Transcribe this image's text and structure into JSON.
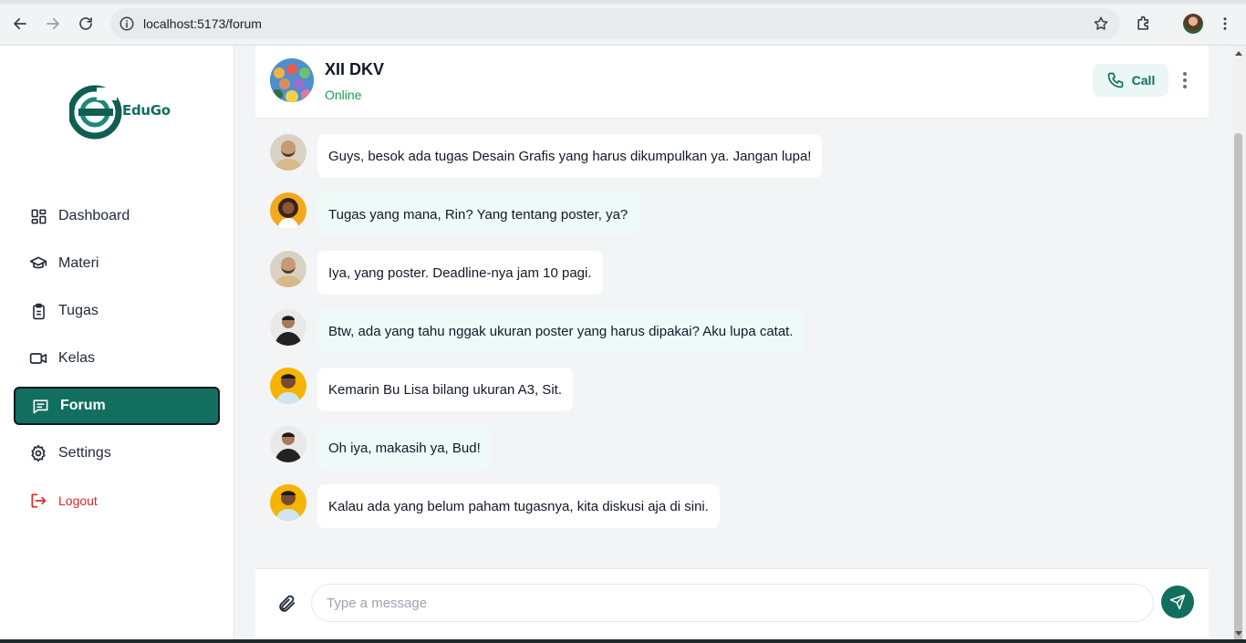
{
  "browser": {
    "url": "localhost:5173/forum"
  },
  "sidebar": {
    "logo_text": "EduGo",
    "items": [
      {
        "label": "Dashboard",
        "icon": "dashboard-icon"
      },
      {
        "label": "Materi",
        "icon": "graduation-cap-icon"
      },
      {
        "label": "Tugas",
        "icon": "clipboard-icon"
      },
      {
        "label": "Kelas",
        "icon": "video-icon"
      },
      {
        "label": "Forum",
        "icon": "message-icon",
        "active": true
      },
      {
        "label": "Settings",
        "icon": "gear-icon"
      }
    ],
    "logout_label": "Logout"
  },
  "chat": {
    "group_name": "XII DKV",
    "status": "Online",
    "call_label": "Call"
  },
  "messages": [
    {
      "text": "Guys, besok ada tugas Desain Grafis yang harus dikumpulkan ya. Jangan lupa!",
      "style": "white",
      "avatar": "man-beard-1"
    },
    {
      "text": "Tugas yang mana, Rin? Yang tentang poster, ya?",
      "style": "mint",
      "avatar": "woman-curly"
    },
    {
      "text": "Iya, yang poster. Deadline-nya jam 10 pagi.",
      "style": "white",
      "avatar": "man-beard-1"
    },
    {
      "text": "Btw, ada yang tahu nggak ukuran poster yang harus dipakai? Aku lupa catat.",
      "style": "mint",
      "avatar": "man-dark-suit"
    },
    {
      "text": "Kemarin Bu Lisa bilang ukuran A3, Sit.",
      "style": "white",
      "avatar": "man-yellow-bg"
    },
    {
      "text": "Oh iya, makasih ya, Bud!",
      "style": "mint",
      "avatar": "man-dark-suit"
    },
    {
      "text": "Kalau ada yang belum paham tugasnya, kita diskusi aja di sini.",
      "style": "white",
      "avatar": "man-yellow-bg"
    }
  ],
  "composer": {
    "placeholder": "Type a message",
    "value": ""
  },
  "colors": {
    "brand": "#126e5f",
    "status_online": "#16a34a",
    "logout": "#dc2626",
    "mint_bubble": "#eefaf7"
  }
}
